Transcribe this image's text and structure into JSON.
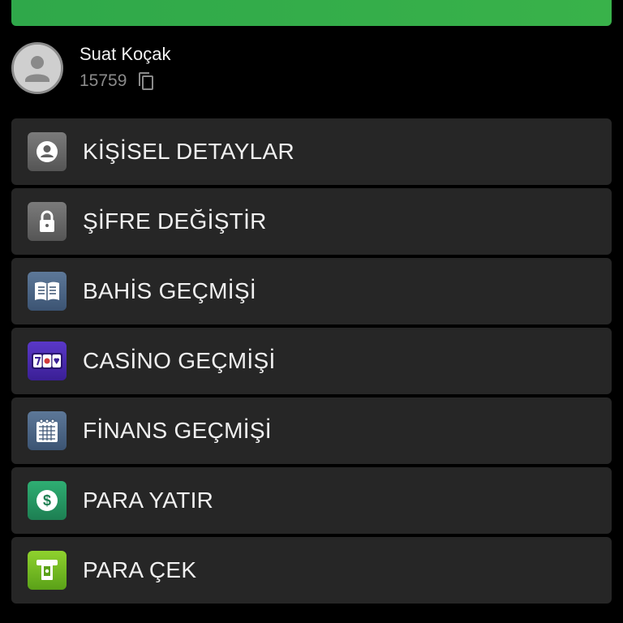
{
  "header": {
    "accent_color": "#39b24a"
  },
  "profile": {
    "name": "Suat Koçak",
    "user_id": "15759"
  },
  "menu": {
    "items": [
      {
        "label": "KİŞİSEL DETAYLAR",
        "icon": "person-icon"
      },
      {
        "label": "ŞİFRE DEĞİŞTİR",
        "icon": "lock-icon"
      },
      {
        "label": "BAHİS GEÇMİŞİ",
        "icon": "book-icon"
      },
      {
        "label": "CASİNO GEÇMİŞİ",
        "icon": "slot-machine-icon"
      },
      {
        "label": "FİNANS GEÇMİŞİ",
        "icon": "calendar-grid-icon"
      },
      {
        "label": "PARA YATIR",
        "icon": "dollar-icon"
      },
      {
        "label": "PARA ÇEK",
        "icon": "atm-withdraw-icon"
      }
    ]
  },
  "colors": {
    "background": "#000000",
    "item_background": "#262626",
    "text": "#f0f0f0",
    "muted_text": "#8a8a8a"
  }
}
